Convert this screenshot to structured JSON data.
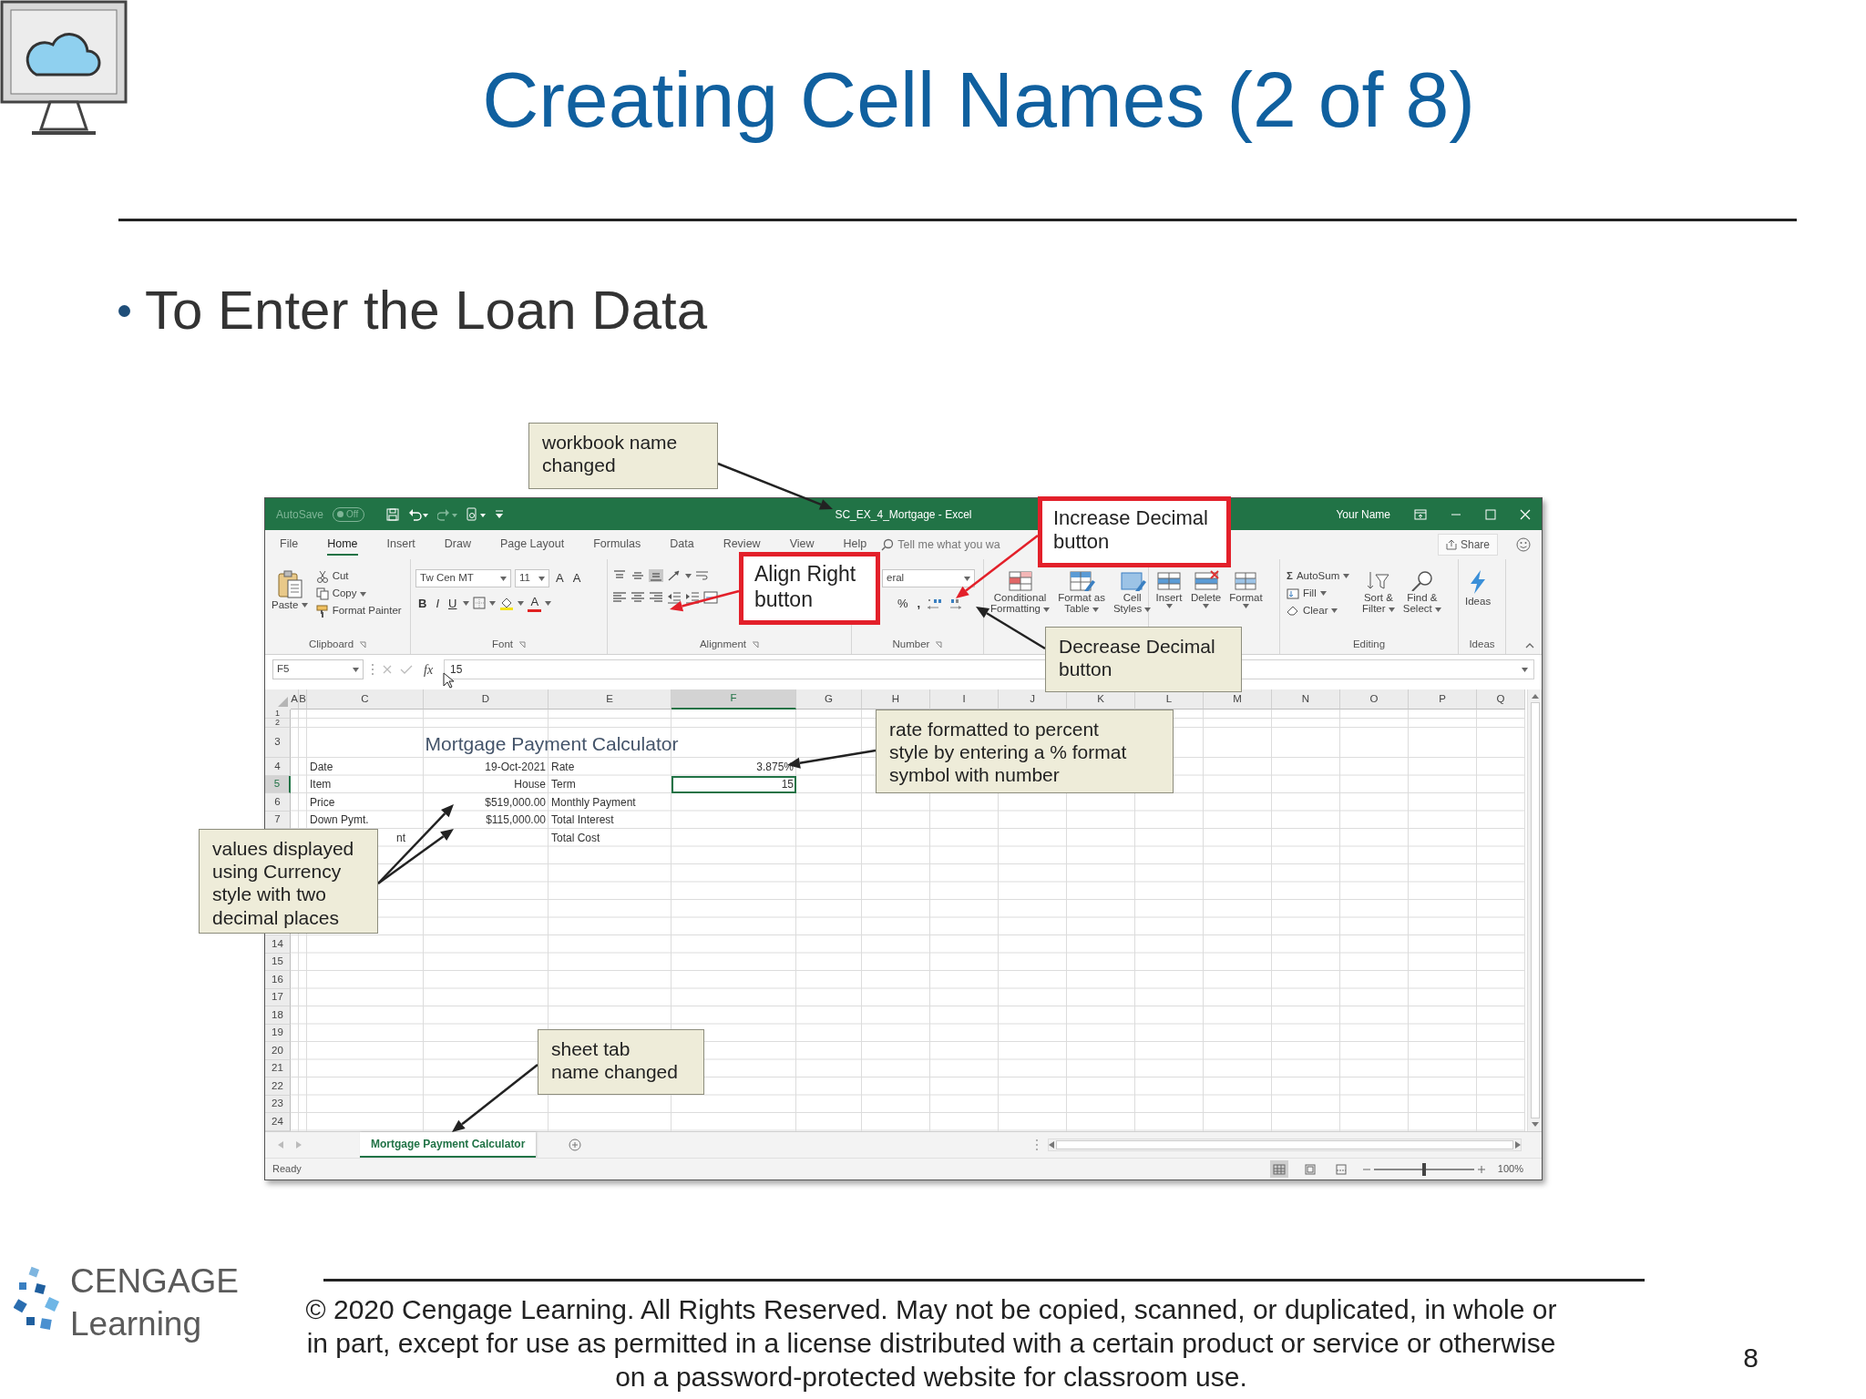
{
  "slide": {
    "title": "Creating Cell Names (2 of 8)",
    "bullets": [
      "To Enter the Loan Data"
    ]
  },
  "excel": {
    "title_bar": {
      "autosave": "AutoSave",
      "autosave_state": "Off",
      "title": "SC_EX_4_Mortgage - Excel",
      "user": "Your Name"
    },
    "tabs": [
      {
        "label": "File",
        "selected": false
      },
      {
        "label": "Home",
        "selected": true
      },
      {
        "label": "Insert",
        "selected": false
      },
      {
        "label": "Draw",
        "selected": false
      },
      {
        "label": "Page Layout",
        "selected": false
      },
      {
        "label": "Formulas",
        "selected": false
      },
      {
        "label": "Data",
        "selected": false
      },
      {
        "label": "Review",
        "selected": false
      },
      {
        "label": "View",
        "selected": false
      },
      {
        "label": "Help",
        "selected": false
      }
    ],
    "tell_me": "Tell me what you wa",
    "share": "Share",
    "ribbon": {
      "clipboard": {
        "paste": "Paste",
        "cut": "Cut",
        "copy": "Copy",
        "format_painter": "Format Painter",
        "label": "Clipboard"
      },
      "font": {
        "font_name": "Tw Cen MT",
        "font_size": "11",
        "grow": "A",
        "shrink": "A",
        "bold": "B",
        "italic": "I",
        "underline": "U",
        "font_color": "A",
        "label": "Font"
      },
      "alignment": {
        "label": "Alignment"
      },
      "number": {
        "format": "eral",
        "percent": "%",
        "comma": ",",
        "label": "Number"
      },
      "styles": {
        "conditional": "Conditional\nFormatting",
        "format_table": "Format as\nTable",
        "cell_styles": "Cell\nStyles"
      },
      "cells": {
        "insert": "Insert",
        "delete": "Delete",
        "format": "Format"
      },
      "editing": {
        "autosum_symbol": "Σ",
        "autosum": "AutoSum",
        "fill": "Fill",
        "clear": "Clear",
        "sort_filter": "Sort &\nFilter",
        "find_select": "Find &\nSelect",
        "label": "Editing"
      },
      "ideas": {
        "button": "Ideas",
        "label": "Ideas"
      }
    },
    "formula_bar": {
      "name_box": "F5",
      "fx": "fx",
      "value": "15"
    },
    "columns": [
      {
        "letter": "A",
        "selected": false
      },
      {
        "letter": "B",
        "selected": false
      },
      {
        "letter": "C",
        "selected": false
      },
      {
        "letter": "D",
        "selected": false
      },
      {
        "letter": "E",
        "selected": false
      },
      {
        "letter": "F",
        "selected": true
      },
      {
        "letter": "G",
        "selected": false
      },
      {
        "letter": "H",
        "selected": false
      },
      {
        "letter": "I",
        "selected": false
      },
      {
        "letter": "J",
        "selected": false
      },
      {
        "letter": "K",
        "selected": false
      },
      {
        "letter": "L",
        "selected": false
      },
      {
        "letter": "M",
        "selected": false
      },
      {
        "letter": "N",
        "selected": false
      },
      {
        "letter": "O",
        "selected": false
      },
      {
        "letter": "P",
        "selected": false
      },
      {
        "letter": "Q",
        "selected": false
      }
    ],
    "rows": [
      {
        "number": "1",
        "kind": "short",
        "selected": false
      },
      {
        "number": "2",
        "kind": "short",
        "selected": false
      },
      {
        "number": "3",
        "kind": "tall",
        "selected": false,
        "cells": {
          "C": {
            "kind": "title",
            "text": "Mortgage Payment Calculator",
            "selected": false
          }
        }
      },
      {
        "number": "4",
        "kind": "normal",
        "selected": false,
        "cells": {
          "C": {
            "kind": "label",
            "text": "Date",
            "selected": false
          },
          "D": {
            "kind": "value",
            "text": "19-Oct-2021",
            "selected": false
          },
          "E": {
            "kind": "label",
            "text": "Rate",
            "selected": false
          },
          "F": {
            "kind": "value",
            "text": "3.875%",
            "selected": false
          }
        }
      },
      {
        "number": "5",
        "kind": "normal",
        "selected": true,
        "cells": {
          "C": {
            "kind": "label",
            "text": "Item",
            "selected": false
          },
          "D": {
            "kind": "value",
            "text": "House",
            "selected": false
          },
          "E": {
            "kind": "label",
            "text": "Term",
            "selected": false
          },
          "F": {
            "kind": "value",
            "text": "15",
            "selected": true
          }
        }
      },
      {
        "number": "6",
        "kind": "normal",
        "selected": false,
        "cells": {
          "C": {
            "kind": "label",
            "text": "Price",
            "selected": false
          },
          "D": {
            "kind": "value",
            "text": "$519,000.00",
            "selected": false
          },
          "E": {
            "kind": "label",
            "text": "Monthly Payment",
            "selected": false
          }
        }
      },
      {
        "number": "7",
        "kind": "normal",
        "selected": false,
        "cells": {
          "C": {
            "kind": "label",
            "text": "Down Pymt.",
            "selected": false
          },
          "D": {
            "kind": "value",
            "text": "$115,000.00",
            "selected": false
          },
          "E": {
            "kind": "label",
            "text": "Total Interest",
            "selected": false
          }
        }
      },
      {
        "kind": "normal",
        "cells": {
          "C": {
            "kind": "partial",
            "text": "nt",
            "selected": false
          },
          "E": {
            "kind": "label",
            "text": "Total Cost",
            "selected": false
          }
        }
      },
      {
        "kind": "normal"
      },
      {
        "kind": "normal"
      },
      {
        "kind": "normal"
      },
      {
        "kind": "normal"
      },
      {
        "kind": "normal"
      },
      {
        "number": "14",
        "kind": "normal",
        "selected": false
      },
      {
        "number": "15",
        "kind": "normal",
        "selected": false
      },
      {
        "number": "16",
        "kind": "normal",
        "selected": false
      },
      {
        "number": "17",
        "kind": "normal",
        "selected": false
      },
      {
        "number": "18",
        "kind": "normal",
        "selected": false
      },
      {
        "number": "19",
        "kind": "normal",
        "selected": false
      },
      {
        "number": "20",
        "kind": "normal",
        "selected": false
      },
      {
        "number": "21",
        "kind": "normal",
        "selected": false
      },
      {
        "number": "22",
        "kind": "normal",
        "selected": false
      },
      {
        "number": "23",
        "kind": "normal",
        "selected": false
      },
      {
        "number": "24",
        "kind": "normal",
        "selected": false
      }
    ],
    "sheet_tabs": [
      {
        "label": "Mortgage Payment Calculator",
        "selected": true
      }
    ],
    "status_bar": {
      "text": "Ready",
      "zoom": {
        "reading": "100%",
        "level": 0.5
      }
    }
  },
  "callouts": [
    {
      "kind": "note",
      "text": "workbook name\nchanged"
    },
    {
      "kind": "highlight",
      "text": "Increase Decimal\nbutton"
    },
    {
      "kind": "highlight",
      "text": "Align Right\nbutton"
    },
    {
      "kind": "note",
      "text": "Decrease Decimal\nbutton"
    },
    {
      "kind": "note",
      "text": "rate formatted to percent\nstyle by entering a % format\nsymbol with number"
    },
    {
      "kind": "note",
      "text": "values displayed\nusing Currency\nstyle with two\ndecimal places"
    },
    {
      "kind": "note",
      "text": "sheet tab\nname changed"
    }
  ],
  "footer": {
    "logo_top": "CENGAGE",
    "logo_bottom": "Learning",
    "copyright": "© 2020 Cengage Learning. All Rights Reserved. May not be copied, scanned, or duplicated, in whole or in part, except for use as permitted in a license distributed with a certain product or service or otherwise on a password-protected website for classroom use.",
    "page_number": "8"
  }
}
